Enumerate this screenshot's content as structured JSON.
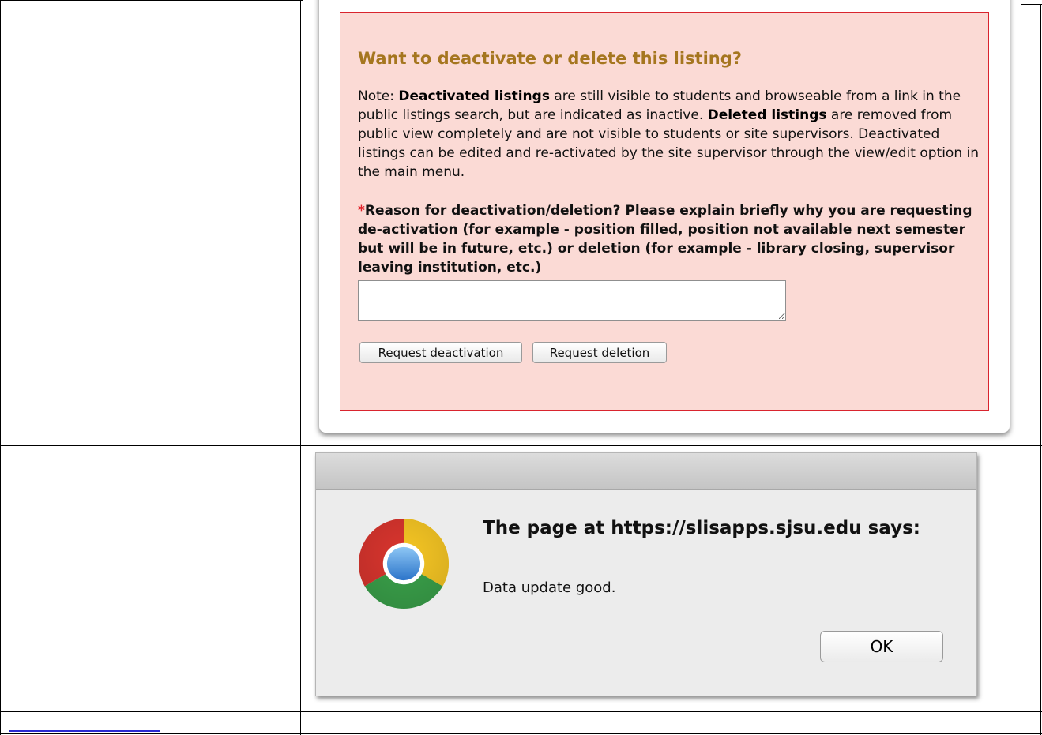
{
  "deactivate_panel": {
    "title": "Want to deactivate or delete this listing?",
    "note": {
      "prefix": "Note: ",
      "deactivated_term": "Deactivated listings",
      "deactivated_desc": " are still visible to students and browseable from a link in the public listings search, but are indicated as inactive. ",
      "deleted_term": "Deleted listings",
      "deleted_desc": " are removed from public view completely and are not visible to students or site supervisors. Deactivated listings can be edited and re-activated by the site supervisor through the view/edit option in the main menu."
    },
    "reason_required_marker": "*",
    "reason_label": "Reason for deactivation/deletion? Please explain briefly why you are requesting de-activation (for example - position filled, position not available next semester but will be in future, etc.) or deletion (for example - library closing, supervisor leaving institution, etc.)",
    "reason_value": "",
    "buttons": {
      "deactivate": "Request deactivation",
      "delete": "Request deletion"
    },
    "colors": {
      "box_background": "#fbdad5",
      "box_border": "#d9242e",
      "title": "#a5761f",
      "required_marker": "#e0222a"
    }
  },
  "alert_dialog": {
    "heading": "The page at https://slisapps.sjsu.edu says:",
    "message": "Data update good.",
    "ok_label": "OK",
    "icon": "chrome-logo-icon"
  }
}
